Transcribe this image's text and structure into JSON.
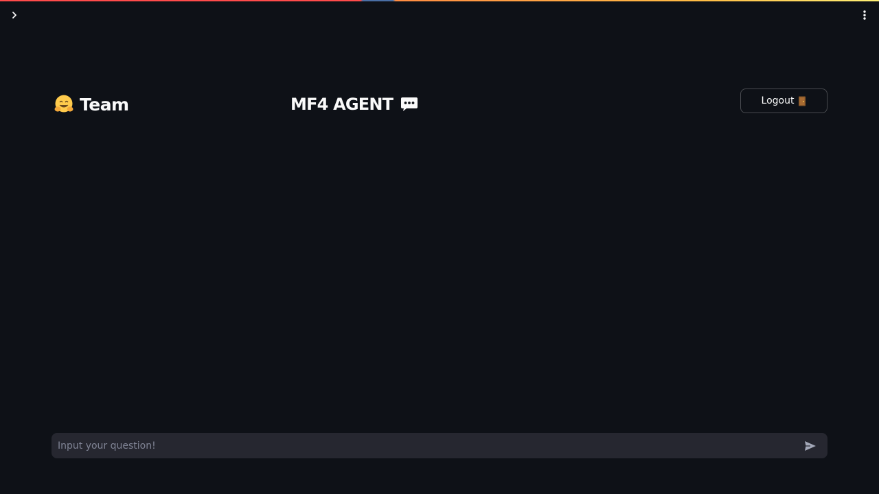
{
  "header": {
    "sidebar_toggle_icon": "chevron-right-icon",
    "menu_icon": "more-vertical-icon",
    "progress_colors": [
      "#ff4b4b",
      "#4a6fa5",
      "#ffbd45",
      "#fff176"
    ]
  },
  "team": {
    "emoji": "🤗",
    "title": "Team"
  },
  "app": {
    "title": "MF4 AGENT",
    "icon": "chat-bubble-icon"
  },
  "logout": {
    "label": "Logout",
    "icon": "door-icon"
  },
  "chat": {
    "placeholder": "Input your question!",
    "value": "",
    "send_icon": "send-icon"
  },
  "theme": {
    "background": "#0e1117",
    "input_background": "#262730",
    "text": "#fafafa",
    "muted": "#808495"
  }
}
